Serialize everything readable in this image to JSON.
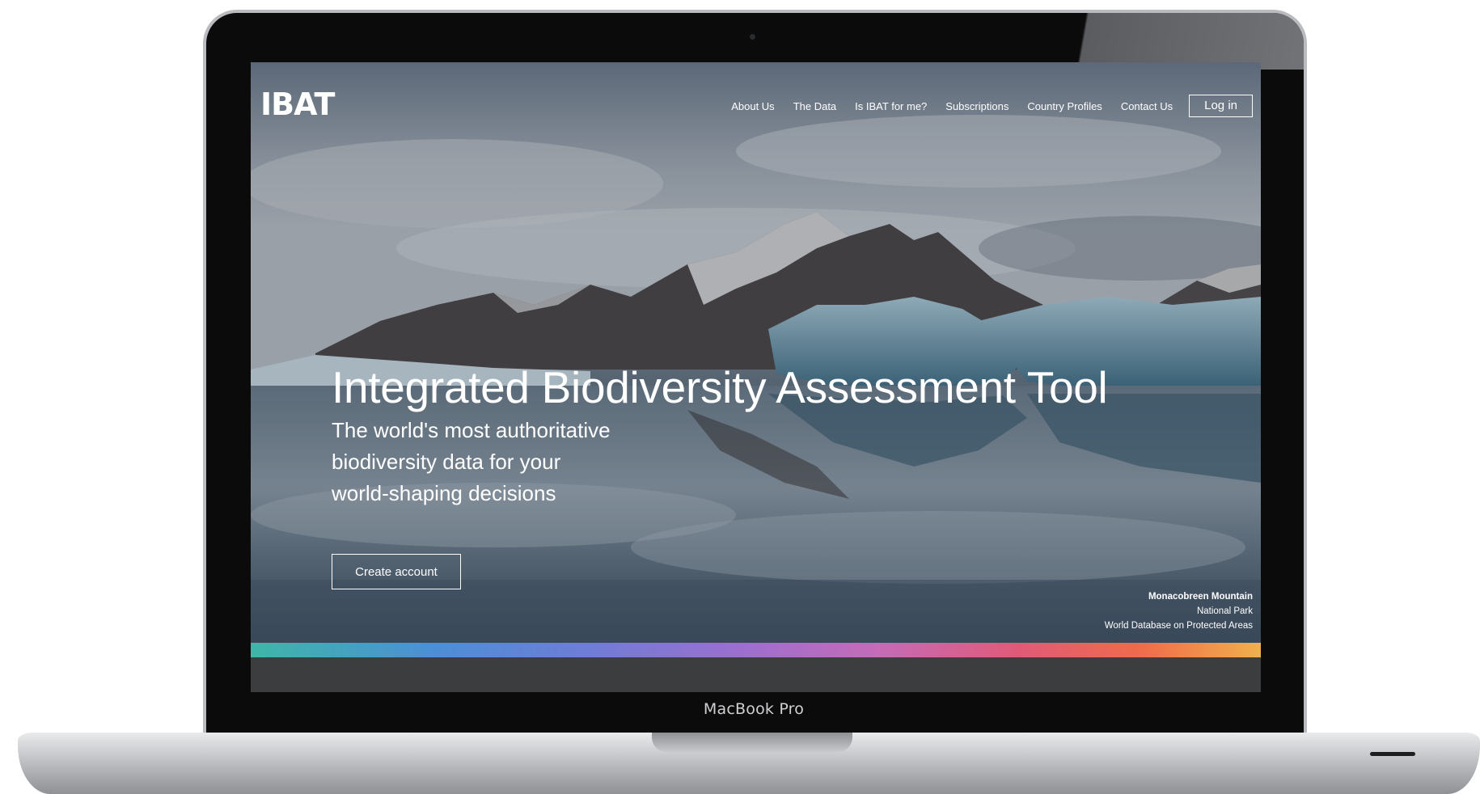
{
  "device": {
    "model_label": "MacBook Pro"
  },
  "site": {
    "logo_text": "IBAT",
    "nav": {
      "items": [
        {
          "label": "About Us"
        },
        {
          "label": "The Data"
        },
        {
          "label": "Is IBAT for me?"
        },
        {
          "label": "Subscriptions"
        },
        {
          "label": "Country Profiles"
        },
        {
          "label": "Contact Us"
        }
      ],
      "login_label": "Log in"
    },
    "hero": {
      "title": "Integrated Biodiversity Assessment Tool",
      "subtitle": "The world's most authoritative biodiversity data for your world-shaping decisions",
      "cta_label": "Create account",
      "photo_caption": {
        "title": "Monacobreen Mountain",
        "line2": "National Park",
        "line3": "World Database on Protected Areas"
      }
    },
    "colors": {
      "accent_gradient": [
        "#3fb6a8",
        "#4b8fd6",
        "#9a6fd0",
        "#e05a78",
        "#f1b04d"
      ],
      "text": "#ffffff"
    }
  }
}
